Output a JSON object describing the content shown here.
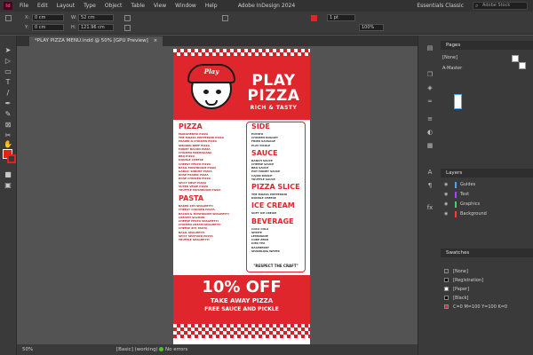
{
  "menubar": {
    "logo": "Id",
    "items": [
      "File",
      "Edit",
      "Layout",
      "Type",
      "Object",
      "Table",
      "View",
      "Window",
      "Help"
    ],
    "app_title": "Adobe InDesign 2024",
    "workspace": "Essentials Classic",
    "search_placeholder": "Adobe Stock"
  },
  "control": {
    "x_label": "X:",
    "x_value": "0 cm",
    "y_label": "Y:",
    "y_value": "0 cm",
    "w_label": "W:",
    "w_value": "52 cm",
    "h_label": "H:",
    "h_value": "121.96 cm",
    "stroke_weight": "1 pt",
    "opacity": "100%"
  },
  "tab": {
    "label": "*PLAY PIZZA MENU.indd @ 50% [GPU Preview]",
    "close": "×"
  },
  "status": {
    "zoom": "50%",
    "preset": "[Basic] (working)",
    "preflight": "No errors"
  },
  "panels": {
    "pages": {
      "title": "Pages",
      "none": "[None]",
      "master": "A-Master"
    },
    "layers": {
      "title": "Layers",
      "items": [
        {
          "name": "Guides",
          "color": "#4fa3ff"
        },
        {
          "name": "Text",
          "color": "#b43cff"
        },
        {
          "name": "Graphics",
          "color": "#3cd37a"
        },
        {
          "name": "Background",
          "color": "#ff3b3b"
        }
      ]
    },
    "swatches": {
      "title": "Swatches",
      "items": [
        "[None]",
        "[Registration]",
        "[Paper]",
        "[Black]",
        "C=0 M=100 Y=100 K=0"
      ]
    }
  },
  "poster": {
    "hat_text": "Play",
    "title_line1": "PLAY",
    "title_line2": "PIZZA",
    "tagline": "RICH & TASTY",
    "categories": {
      "pizza": "PIZZA",
      "pasta": "PASTA",
      "side": "SIDE",
      "sauce": "SAUCE",
      "pizza_slice": "PIZZA SLICE",
      "ice_cream": "ICE CREAM",
      "beverage": "BEVERAGE"
    },
    "pizza_items": [
      "MARGHERITA PIZZA",
      "THE MOZZA PEPPERONI PIZZA",
      "PRAWN N CHICKEN PIZZA",
      "SMOKED BEEF PIZZA",
      "HONEY BACON PIZZA",
      "CHICKEN PARMIGIANA",
      "BBQ PIZZA",
      "DOUBLE CHEESE",
      "CHEESY PESTO PIZZA",
      "BASIL MUSHROOM PIZZA",
      "GARLIC SHRIMP PIZZA",
      "ROSE PRAWN PIZZA",
      "ROSE CHICKEN PIZZA",
      "SPICY MEAT PIZZA",
      "SUPER VEGIE PIZZA",
      "TRUFFLE MUSHROOM PIZZA"
    ],
    "pasta_items": [
      "BAKED ZITI SPAGHETTI",
      "CHEESY CHICKEN PASTA",
      "BACON & MUSHROOM SPAGHETTI",
      "CREAMY SALMON",
      "CHEESE PESTO SPAGHETTI",
      "CHICKEN CREAM SPAGHETTI",
      "CHEESE ZITI PASTA",
      "BASIL SPAGHETTI",
      "SPICY SEAFOOD PASTA",
      "TRUFFLE SPAGHETTI"
    ],
    "side_items": [
      "POTATO",
      "CHICKEN NUGGET",
      "FRIED SAUSAGE",
      "PLAY PICKLE"
    ],
    "sauce_items": [
      "RANCH SAUCE",
      "CHEESE SAUCE",
      "BBQ SAUCE",
      "HOT HONEY SAUCE",
      "CAJUN RANCH",
      "TRUFFLE SAUCE"
    ],
    "slice_items": [
      "THE MOZZA PEPPERONI",
      "DOUBLE CHEESE"
    ],
    "ice_items": [
      "SOFT ICE CREAM"
    ],
    "beverage_items": [
      "COCA COLA",
      "SPRITE",
      "LEMONADE",
      "COKE ZERO",
      "ICED TEA",
      "RASPBERRY",
      "SPARKLING WATER"
    ],
    "slogan": "\"RESPECT THE CRAFT\"",
    "promo_main": "10% OFF",
    "promo_sub": "TAKE AWAY PIZZA",
    "promo_sub2": "FREE SAUCE AND PICKLE"
  },
  "colors": {
    "brand_red": "#e0262d",
    "workspace_bg": "#535353",
    "panel_bg": "#3a3a3a"
  }
}
